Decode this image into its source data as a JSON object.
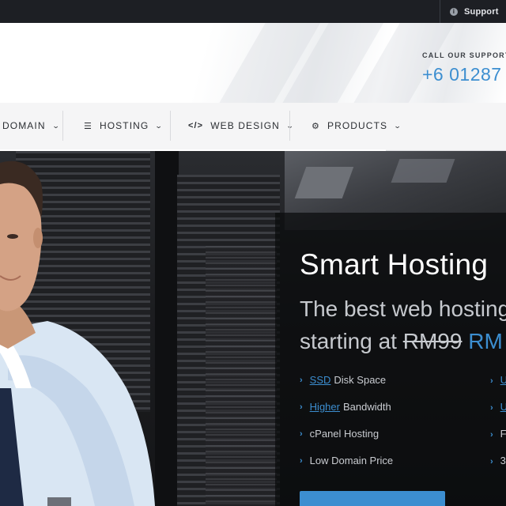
{
  "topbar": {
    "support_label": "Support",
    "support_icon": "info-circle-icon"
  },
  "header": {
    "call_label": "CALL OUR SUPPORT",
    "phone": "+6 01287"
  },
  "nav": {
    "items": [
      {
        "label": "DOMAIN",
        "icon": "globe-icon"
      },
      {
        "label": "HOSTING",
        "icon": "server-list-icon"
      },
      {
        "label": "WEB DESIGN",
        "icon": "code-icon"
      },
      {
        "label": "PRODUCTS",
        "icon": "gears-icon"
      }
    ]
  },
  "hero": {
    "title": "Smart Hosting",
    "subtitle_line1": "The best web hosting",
    "subtitle_prefix": "starting at ",
    "old_price": "RM99",
    "new_price": "RM",
    "features": [
      {
        "highlight": "SSD",
        "text": "Disk Space"
      },
      {
        "highlight": "Higher",
        "text": "Bandwidth"
      },
      {
        "highlight": "",
        "text": "cPanel Hosting"
      },
      {
        "highlight": "",
        "text": "Low Domain Price"
      }
    ],
    "features_right": [
      {
        "highlight": "U",
        "text": ""
      },
      {
        "highlight": "U",
        "text": ""
      },
      {
        "highlight": "",
        "text": "F"
      },
      {
        "highlight": "",
        "text": "3"
      }
    ]
  },
  "colors": {
    "accent": "#3c8ed0",
    "topbar_bg": "#1d1f24",
    "nav_bg": "#f5f5f6"
  }
}
